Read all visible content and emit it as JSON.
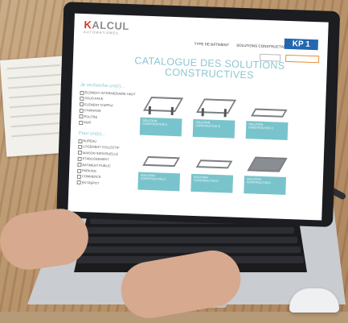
{
  "site": {
    "logo_main": "ALCUL",
    "logo_prefix": "K",
    "logo_sub": "AUTOMATISMES",
    "nav": [
      "TYPE DE BÂTIMENT",
      "SOLUTIONS CONSTRUCTIVES"
    ],
    "badge": "KP 1"
  },
  "page": {
    "title_line1": "CATALOGUE DES SOLUTIONS",
    "title_line2": "CONSTRUCTIVES"
  },
  "filters": {
    "group1_title": "Je recherche un(e)...",
    "group1": [
      "ELEMENT INTERMEDIAIRE HAUT",
      "SOUS-FACE",
      "ELEMENT D'APPUI",
      "CHAINAGE",
      "POUTRE",
      "MUR"
    ],
    "group2_title": "Pour un(e)...",
    "group2": [
      "BUREAU",
      "LOGEMENT COLLECTIF",
      "MAISON INDIVIDUELLE",
      "ETABLISSEMENT",
      "BATIMENT PUBLIC",
      "PARKING",
      "COMMERCE",
      "ENTREPOT"
    ]
  },
  "cards": [
    {
      "caption": "SOLUTION CONSTRUCTIVE A"
    },
    {
      "caption": "SOLUTION CONSTRUCTIVE B"
    },
    {
      "caption": "SOLUTION CONSTRUCTIVE C"
    },
    {
      "caption": "SOLUTION CONSTRUCTIVE D"
    },
    {
      "caption": "SOLUTION CONSTRUCTIVE E"
    },
    {
      "caption": "SOLUTION CONSTRUCTIVE F"
    }
  ],
  "colors": {
    "accent": "#8cc6d0",
    "card_caption": "#79c4cc",
    "badge": "#2367b0",
    "logo_accent": "#d3362b"
  }
}
